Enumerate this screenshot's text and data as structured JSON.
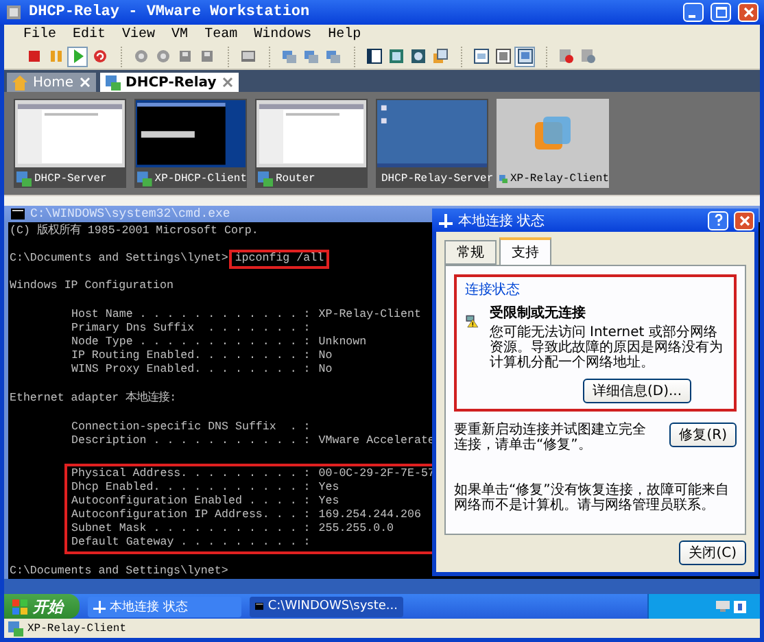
{
  "window": {
    "title": "DHCP-Relay - VMware Workstation"
  },
  "menu": [
    "File",
    "Edit",
    "View",
    "VM",
    "Team",
    "Windows",
    "Help"
  ],
  "toolbar": [
    [
      {
        "kind": "stop",
        "pressed": false
      },
      {
        "kind": "pause",
        "pressed": false
      },
      {
        "kind": "play",
        "pressed": true
      },
      {
        "kind": "reset",
        "pressed": false
      }
    ],
    [
      {
        "kind": "snapshot",
        "pressed": false
      },
      {
        "kind": "snapshot",
        "pressed": false
      },
      {
        "kind": "disk",
        "pressed": false
      },
      {
        "kind": "disk",
        "pressed": false
      }
    ],
    [
      {
        "kind": "console",
        "pressed": false
      }
    ],
    [
      {
        "kind": "network",
        "pressed": false
      },
      {
        "kind": "network",
        "pressed": false
      },
      {
        "kind": "network",
        "pressed": false
      }
    ],
    [
      {
        "kind": "sidebar",
        "pressed": false
      },
      {
        "kind": "fullscreen",
        "pressed": false
      },
      {
        "kind": "unity",
        "pressed": false
      },
      {
        "kind": "windows",
        "pressed": false
      }
    ],
    [
      {
        "kind": "summary",
        "pressed": false
      },
      {
        "kind": "appliance",
        "pressed": false
      },
      {
        "kind": "screen",
        "pressed": true
      }
    ],
    [
      {
        "kind": "record",
        "pressed": false
      },
      {
        "kind": "replay",
        "pressed": false
      }
    ]
  ],
  "tabs": [
    {
      "label": "Home",
      "kind": "home",
      "selected": false
    },
    {
      "label": "DHCP-Relay",
      "kind": "vm",
      "selected": true
    }
  ],
  "thumbnails": [
    {
      "name": "DHCP-Server",
      "selected": false
    },
    {
      "name": "XP-DHCP-Client",
      "selected": false
    },
    {
      "name": "Router",
      "selected": false
    },
    {
      "name": "DHCP-Relay-Server",
      "selected": false
    },
    {
      "name": "XP-Relay-Client",
      "selected": true
    }
  ],
  "console": {
    "title": "C:\\WINDOWS\\system32\\cmd.exe",
    "blocks": [
      {
        "kind": "text",
        "text": "(C) 版权所有 1985-2001 Microsoft Corp."
      },
      {
        "kind": "prompt",
        "prompt": "C:\\Documents and Settings\\lynet>",
        "command": "ipconfig /all",
        "highlighted": true
      },
      {
        "kind": "text",
        "text": "Windows IP Configuration"
      },
      {
        "kind": "fields",
        "highlighted": false,
        "rows": [
          {
            "label": "Host Name . . . . . . . . . . . . :",
            "value": "XP-Relay-Client"
          },
          {
            "label": "Primary Dns Suffix  . . . . . . . :"
          },
          {
            "label": "Node Type . . . . . . . . . . . . :",
            "value": "Unknown"
          },
          {
            "label": "IP Routing Enabled. . . . . . . . :",
            "value": "No"
          },
          {
            "label": "WINS Proxy Enabled. . . . . . . . :",
            "value": "No"
          }
        ]
      },
      {
        "kind": "text",
        "text": "Ethernet adapter 本地连接:"
      },
      {
        "kind": "fields",
        "highlighted": false,
        "rows": [
          {
            "label": "Connection-specific DNS Suffix  . :"
          },
          {
            "label": "Description . . . . . . . . . . . :",
            "value": "VMware Accelerate"
          }
        ]
      },
      {
        "kind": "fields",
        "highlighted": true,
        "rows": [
          {
            "label": "Physical Address. . . . . . . . . :",
            "value": "00-0C-29-2F-7E-57"
          },
          {
            "label": "Dhcp Enabled. . . . . . . . . . . :",
            "value": "Yes"
          },
          {
            "label": "Autoconfiguration Enabled . . . . :",
            "value": "Yes"
          },
          {
            "label": "Autoconfiguration IP Address. . . :",
            "value": "169.254.244.206"
          },
          {
            "label": "Subnet Mask . . . . . . . . . . . :",
            "value": "255.255.0.0"
          },
          {
            "label": "Default Gateway . . . . . . . . . :"
          }
        ]
      },
      {
        "kind": "prompt",
        "prompt": "C:\\Documents and Settings\\lynet>"
      }
    ]
  },
  "dialog": {
    "title": "本地连接 状态",
    "tabs": [
      {
        "label": "常规",
        "selected": false
      },
      {
        "label": "支持",
        "selected": true
      }
    ],
    "group": {
      "title": "连接状态",
      "highlighted": true,
      "heading": "受限制或无连接",
      "message": "您可能无法访问 Internet 或部分网络资源。导致此故障的原因是网络没有为计算机分配一个网络地址。",
      "button": "详细信息(D)..."
    },
    "repair_text": "要重新启动连接并试图建立完全连接，请单击“修复”。",
    "repair_button": "修复(R)",
    "help_text": "如果单击“修复”没有恢复连接，故障可能来自网络而不是计算机。请与网络管理员联系。",
    "close_button": "关闭(C)"
  },
  "taskbar": {
    "start": "开始",
    "tasks": [
      {
        "label": "本地连接 状态",
        "kind": "network",
        "selected": false
      },
      {
        "label": "C:\\WINDOWS\\syste...",
        "kind": "console",
        "selected": true
      }
    ]
  },
  "status_bar": {
    "text": "XP-Relay-Client"
  }
}
